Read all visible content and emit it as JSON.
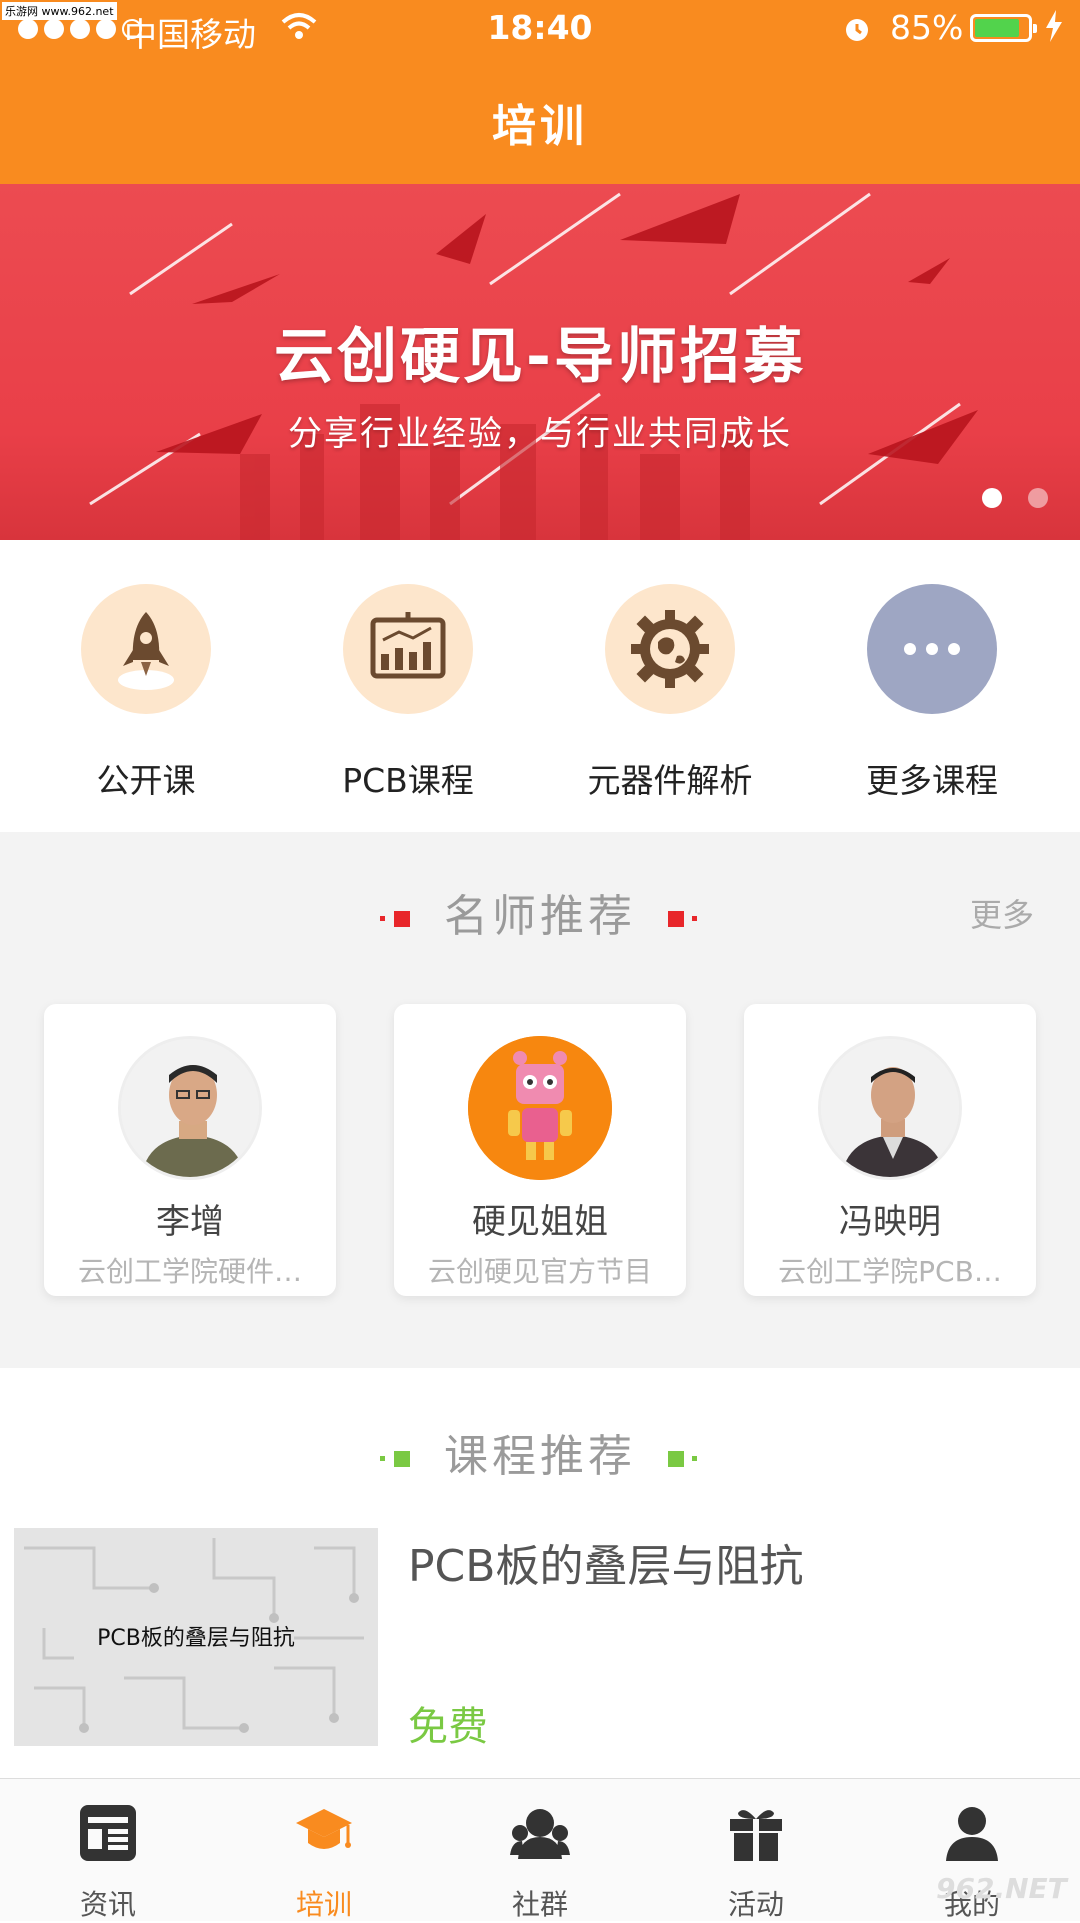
{
  "status_bar": {
    "carrier": "中国移动",
    "time": "18:40",
    "battery_percent": "85%",
    "battery_level": 0.85,
    "signal_bars_filled": 4,
    "signal_bars_total": 5
  },
  "header": {
    "title": "培训"
  },
  "banner": {
    "title": "云创硬见-导师招募",
    "subtitle": "分享行业经验，与行业共同成长",
    "active_slide": 1,
    "slide_count": 2
  },
  "categories": [
    {
      "label": "公开课",
      "icon": "rocket-icon",
      "bg": "#fde6cc"
    },
    {
      "label": "PCB课程",
      "icon": "chart-board-icon",
      "bg": "#fde6cc"
    },
    {
      "label": "元器件解析",
      "icon": "globe-gear-icon",
      "bg": "#fde6cc"
    },
    {
      "label": "更多课程",
      "icon": "more-dots-icon",
      "bg": "#9ea6c3"
    }
  ],
  "teachers_section": {
    "title": "名师推荐",
    "more_label": "更多",
    "accent": "#e8262a",
    "teachers": [
      {
        "name": "李增",
        "desc": "云创工学院硬件…"
      },
      {
        "name": "硬见姐姐",
        "desc": "云创硬见官方节目"
      },
      {
        "name": "冯映明",
        "desc": "云创工学院PCB…"
      }
    ]
  },
  "courses_section": {
    "title": "课程推荐",
    "accent": "#7ac943",
    "courses": [
      {
        "title": "PCB板的叠层与阻抗",
        "thumb_text": "PCB板的叠层与阻抗",
        "price": "免费"
      }
    ]
  },
  "tabbar": {
    "active_color": "#f98b1f",
    "tabs": [
      {
        "label": "资讯",
        "icon": "news-icon"
      },
      {
        "label": "培训",
        "icon": "graduation-cap-icon",
        "active": true
      },
      {
        "label": "社群",
        "icon": "community-icon"
      },
      {
        "label": "活动",
        "icon": "gift-icon"
      },
      {
        "label": "我的",
        "icon": "user-icon"
      }
    ]
  },
  "watermarks": {
    "top_left": "乐游网 www.962.net",
    "bottom_right": "962.NET"
  }
}
